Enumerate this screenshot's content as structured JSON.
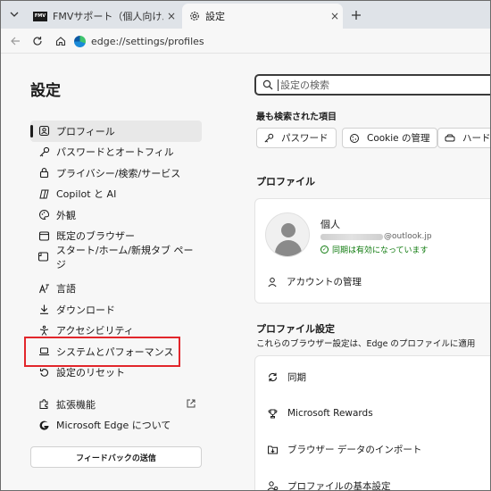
{
  "tabs": {
    "inactive_title": "FMVサポート（個人向けパソコンFMV",
    "inactive_favicon_text": "FMV",
    "active_title": "設定",
    "close_symbol": "×"
  },
  "address": {
    "url": "edge://settings/profiles"
  },
  "page": {
    "heading": "設定"
  },
  "sidebar": {
    "items": [
      {
        "label": "プロフィール",
        "icon": "profile-icon",
        "selected": true
      },
      {
        "label": "パスワードとオートフィル",
        "icon": "key-icon"
      },
      {
        "label": "プライバシー/検索/サービス",
        "icon": "lock-icon"
      },
      {
        "label": "Copilot と AI",
        "icon": "copilot-icon"
      },
      {
        "label": "外観",
        "icon": "palette-icon"
      },
      {
        "label": "既定のブラウザー",
        "icon": "browser-icon"
      },
      {
        "label": "スタート/ホーム/新規タブ ページ",
        "icon": "home-page-icon"
      },
      {
        "label": "言語",
        "icon": "language-icon"
      },
      {
        "label": "ダウンロード",
        "icon": "download-icon"
      },
      {
        "label": "アクセシビリティ",
        "icon": "accessibility-icon"
      },
      {
        "label": "システムとパフォーマンス",
        "icon": "laptop-icon"
      },
      {
        "label": "設定のリセット",
        "icon": "reset-icon"
      },
      {
        "label": "拡張機能",
        "icon": "extensions-icon"
      },
      {
        "label": "Microsoft Edge について",
        "icon": "edge-icon"
      }
    ],
    "feedback_label": "フィードバックの送信"
  },
  "search": {
    "placeholder": "設定の検索"
  },
  "most_searched": {
    "title": "最も検索された項目",
    "chips": [
      "パスワード",
      "Cookie の管理",
      "ハード"
    ]
  },
  "profile": {
    "heading": "プロファイル",
    "name": "個人",
    "email_suffix": "@outlook.jp",
    "sync_status": "同期は有効になっています",
    "manage_account": "アカウントの管理"
  },
  "profile_settings": {
    "heading": "プロファイル設定",
    "description": "これらのブラウザー設定は、Edge のプロファイルに適用",
    "items": [
      "同期",
      "Microsoft Rewards",
      "ブラウザー データのインポート",
      "プロファイルの基本設定"
    ]
  },
  "colors": {
    "highlight": "#e2262b",
    "sync_green": "#0e7a0d"
  }
}
